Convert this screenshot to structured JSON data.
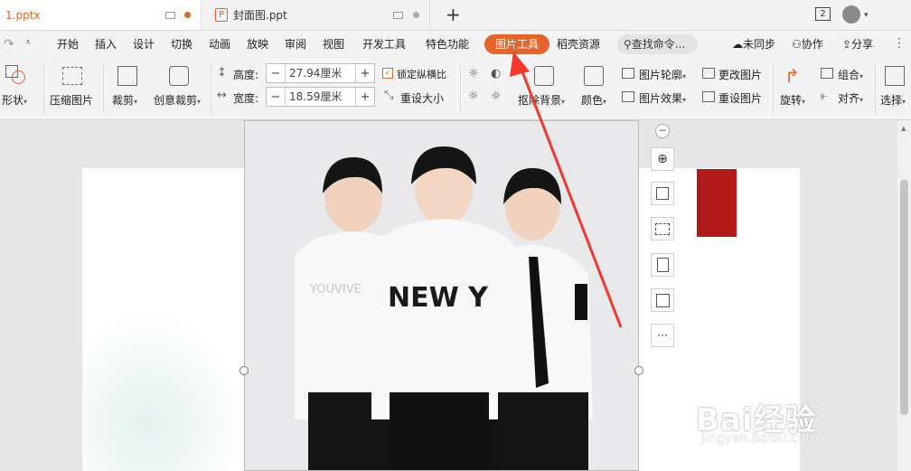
{
  "tabs": [
    {
      "title": "1.pptx"
    },
    {
      "title": "封面图.ppt"
    }
  ],
  "window": {
    "badge": "2"
  },
  "menu": {
    "items": [
      "开始",
      "插入",
      "设计",
      "切换",
      "动画",
      "放映",
      "审阅",
      "视图",
      "开发工具",
      "特色功能"
    ],
    "active": "图片工具",
    "after": "稻壳资源",
    "search": "查找命令...",
    "sync": "未同步",
    "collab": "协作",
    "share": "分享"
  },
  "ribbon": {
    "shape": "形状",
    "compress": "压缩图片",
    "crop": "裁剪",
    "creative_crop": "创意裁剪",
    "height_label": "高度:",
    "height_value": "27.94厘米",
    "width_label": "宽度:",
    "width_value": "18.59厘米",
    "lock_ratio": "锁定纵横比",
    "reset_size": "重设大小",
    "remove_bg": "抠除背景",
    "color": "颜色",
    "outline": "图片轮廓",
    "effect": "图片效果",
    "change_pic": "更改图片",
    "reset_pic": "重设图片",
    "rotate": "旋转",
    "group": "组合",
    "align": "对齐",
    "select": "选择"
  },
  "float_toolbar": {
    "more": "···"
  },
  "photo": {
    "shirt_text": "NEW YRK",
    "sleeve_text": "YOUVIVE"
  },
  "watermark": {
    "brand": "Bai经验",
    "url": "jingyan.baidu.com"
  },
  "colors": {
    "accent": "#e2652b",
    "red_block": "#b01a1a",
    "arrow": "#f23a2e"
  }
}
